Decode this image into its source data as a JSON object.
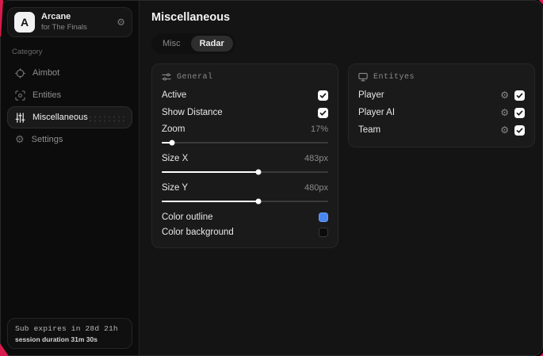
{
  "colors": {
    "accent": "#d81b4c"
  },
  "sidebar": {
    "brand": {
      "logo_letter": "A",
      "name": "Arcane",
      "subtitle": "for The Finals",
      "gear_icon": "gear-icon"
    },
    "category_label": "Category",
    "items": [
      {
        "label": "Aimbot",
        "icon": "crosshair-icon",
        "active": false
      },
      {
        "label": "Entities",
        "icon": "scan-icon",
        "active": false
      },
      {
        "label": "Miscellaneous",
        "icon": "sliders-icon",
        "active": true
      },
      {
        "label": "Settings",
        "icon": "gear-icon",
        "active": false
      }
    ],
    "footer": {
      "line1": "Sub expires in 28d 21h",
      "line2": "session duration 31m 30s"
    }
  },
  "main": {
    "title": "Miscellaneous",
    "tabs": [
      {
        "label": "Misc",
        "active": false
      },
      {
        "label": "Radar",
        "active": true
      }
    ],
    "panels": {
      "general": {
        "header": "General",
        "icon": "sliders-horizontal-icon",
        "rows": [
          {
            "type": "checkbox",
            "label": "Active",
            "checked": true
          },
          {
            "type": "checkbox",
            "label": "Show Distance",
            "checked": true
          },
          {
            "type": "slider",
            "label": "Zoom",
            "value": "17%",
            "percent": 6
          },
          {
            "type": "slider",
            "label": "Size X",
            "value": "483px",
            "percent": 58
          },
          {
            "type": "slider",
            "label": "Size Y",
            "value": "480px",
            "percent": 58
          },
          {
            "type": "color",
            "label": "Color outline",
            "color": "#4a86f0"
          },
          {
            "type": "color",
            "label": "Color background",
            "color": "#0b0b0b"
          }
        ]
      },
      "entities": {
        "header": "Entityes",
        "icon": "monitor-icon",
        "rows": [
          {
            "label": "Player",
            "checked": true
          },
          {
            "label": "Player AI",
            "checked": true
          },
          {
            "label": "Team",
            "checked": true
          }
        ]
      }
    }
  }
}
